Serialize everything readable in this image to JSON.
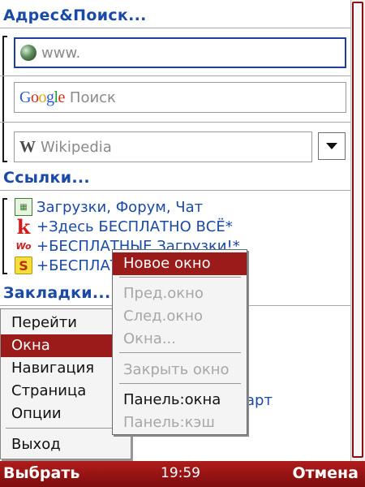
{
  "sections": {
    "address_title": "Адрес&Поиск...",
    "links_title": "Ссылки...",
    "bookmarks_title": "Закладки..."
  },
  "fields": {
    "address_placeholder": "www.",
    "google_logo": "Google",
    "google_placeholder": "Поиск",
    "wiki_placeholder": "Wikipedia"
  },
  "links": [
    {
      "icon": "downloads-grid-icon",
      "label": "Загрузки, Форум, Чат"
    },
    {
      "icon": "k-logo-icon",
      "label": "+Здесь БЕСПЛАТНО ВСЁ*"
    },
    {
      "icon": "wap-logo-icon",
      "label": "+БЕСПЛАТНЫЕ Загрузки!*"
    },
    {
      "icon": "s-logo-icon",
      "label": "+БЕСПЛАТНО"
    }
  ],
  "bookmarks_partial": "арт",
  "main_menu": {
    "items": [
      "Перейти",
      "Окна",
      "Навигация",
      "Страница",
      "Опции"
    ],
    "exit": "Выход",
    "selected": "Окна"
  },
  "sub_menu": {
    "new_window": "Новое окно",
    "prev_window": "Пред.окно",
    "next_window": "След.окно",
    "windows": "Окна...",
    "close_window": "Закрыть окно",
    "panel_windows": "Панель:окна",
    "panel_cache": "Панель:кэш"
  },
  "softkeys": {
    "left": "Выбрать",
    "time": "19:59",
    "right": "Отмена"
  },
  "colors": {
    "accent": "#9b1a1a",
    "link": "#1a4aa8",
    "active_field": "#1f3f9c"
  }
}
